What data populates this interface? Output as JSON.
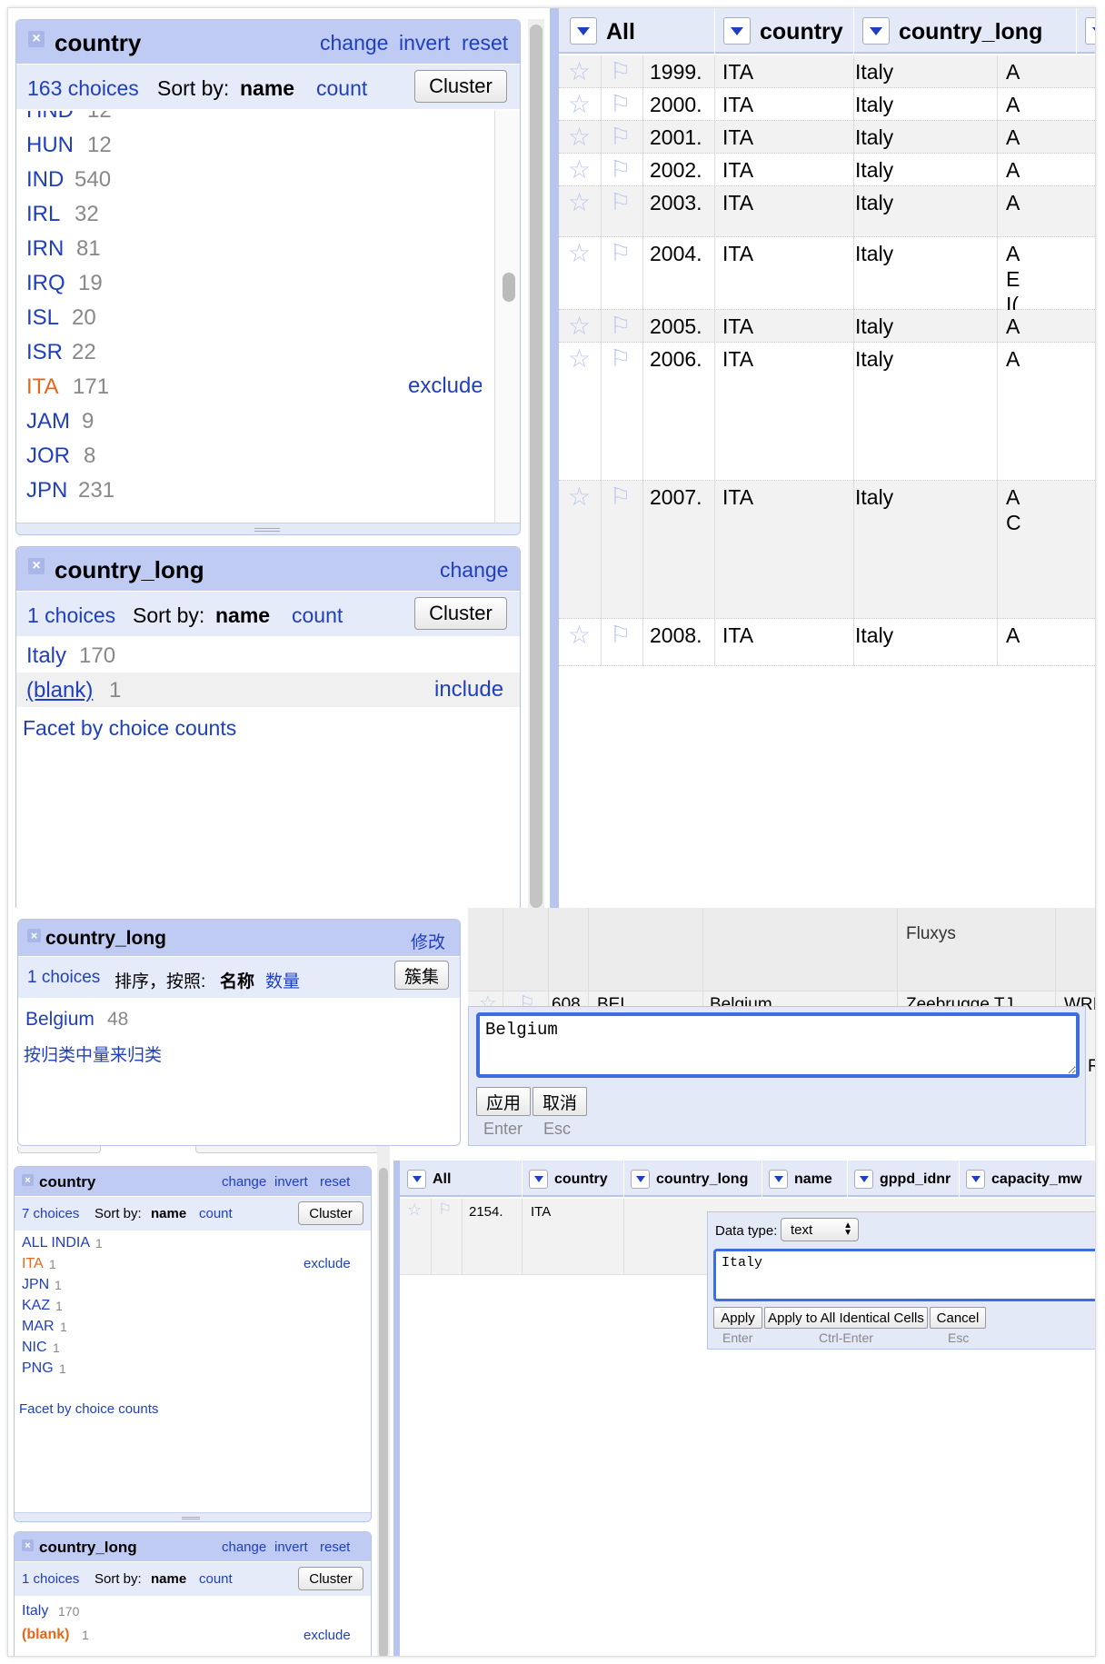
{
  "panel1": {
    "facet_country": {
      "title": "country",
      "actions": [
        "change",
        "invert",
        "reset"
      ],
      "choices_text": "163 choices",
      "sort_by": "Sort by:",
      "sort_name": "name",
      "sort_count": "count",
      "cluster": "Cluster",
      "items": [
        {
          "label": "HND",
          "count": "12"
        },
        {
          "label": "HUN",
          "count": "12"
        },
        {
          "label": "IND",
          "count": "540"
        },
        {
          "label": "IRL",
          "count": "32"
        },
        {
          "label": "IRN",
          "count": "81"
        },
        {
          "label": "IRQ",
          "count": "19"
        },
        {
          "label": "ISL",
          "count": "20"
        },
        {
          "label": "ISR",
          "count": "22"
        },
        {
          "label": "ITA",
          "count": "171",
          "action": "exclude"
        },
        {
          "label": "JAM",
          "count": "9"
        },
        {
          "label": "JOR",
          "count": "8"
        },
        {
          "label": "JPN",
          "count": "231"
        }
      ]
    },
    "facet_country_long": {
      "title": "country_long",
      "change": "change",
      "choices_text": "1 choices",
      "sort_by": "Sort by:",
      "sort_name": "name",
      "sort_count": "count",
      "cluster": "Cluster",
      "items": [
        {
          "label": "Italy",
          "count": "170"
        },
        {
          "label": "(blank)",
          "count": "1",
          "action": "include"
        }
      ],
      "facet_by_counts": "Facet by choice counts"
    },
    "columns": [
      "All",
      "country",
      "country_long"
    ],
    "rows": [
      {
        "n": "1999.",
        "c": "ITA",
        "cl": "Italy",
        "x": [
          "A"
        ]
      },
      {
        "n": "2000.",
        "c": "ITA",
        "cl": "Italy",
        "x": [
          "A"
        ]
      },
      {
        "n": "2001.",
        "c": "ITA",
        "cl": "Italy",
        "x": [
          "A"
        ]
      },
      {
        "n": "2002.",
        "c": "ITA",
        "cl": "Italy",
        "x": [
          "A"
        ]
      },
      {
        "n": "2003.",
        "c": "ITA",
        "cl": "Italy",
        "x": [
          "A"
        ]
      },
      {
        "n": "2004.",
        "c": "ITA",
        "cl": "Italy",
        "x": [
          "A",
          "E",
          "I("
        ]
      },
      {
        "n": "2005.",
        "c": "ITA",
        "cl": "Italy",
        "x": [
          "A"
        ]
      },
      {
        "n": "2006.",
        "c": "ITA",
        "cl": "Italy",
        "x": [
          "A"
        ]
      },
      {
        "n": "2007.",
        "c": "ITA",
        "cl": "Italy",
        "x": [
          "A",
          "C"
        ]
      },
      {
        "n": "2008.",
        "c": "ITA",
        "cl": "Italy",
        "x": [
          "A"
        ]
      }
    ]
  },
  "panel2": {
    "facet": {
      "title": "country_long",
      "change": "修改",
      "choices_text": "1 choices",
      "sort_by": "排序，按照:",
      "sort_name": "名称",
      "sort_count": "数量",
      "cluster": "簇集",
      "item_label": "Belgium",
      "item_count": "48",
      "facet_by_counts": "按归类中量来归类"
    },
    "top_row_text": "Fluxys",
    "row": {
      "n": "608.",
      "c": "BEL",
      "cl": "Belgium",
      "name": "Zeebrugge TJ",
      "x": "WRI"
    },
    "editor_value": "Belgium",
    "apply": "应用",
    "cancel": "取消",
    "enter": "Enter",
    "esc": "Esc",
    "right_edge": "RI"
  },
  "panel3": {
    "facet_country": {
      "title": "country",
      "actions": [
        "change",
        "invert",
        "reset"
      ],
      "choices_text": "7 choices",
      "sort_by": "Sort by:",
      "sort_name": "name",
      "sort_count": "count",
      "cluster": "Cluster",
      "items": [
        {
          "label": "ALL INDIA",
          "count": "1"
        },
        {
          "label": "ITA",
          "count": "1",
          "action": "exclude"
        },
        {
          "label": "JPN",
          "count": "1"
        },
        {
          "label": "KAZ",
          "count": "1"
        },
        {
          "label": "MAR",
          "count": "1"
        },
        {
          "label": "NIC",
          "count": "1"
        },
        {
          "label": "PNG",
          "count": "1"
        }
      ],
      "facet_by_counts": "Facet by choice counts"
    },
    "facet_country_long": {
      "title": "country_long",
      "actions": [
        "change",
        "invert",
        "reset"
      ],
      "choices_text": "1 choices",
      "sort_by": "Sort by:",
      "sort_name": "name",
      "sort_count": "count",
      "cluster": "Cluster",
      "items": [
        {
          "label": "Italy",
          "count": "170"
        },
        {
          "label": "(blank)",
          "count": "1",
          "action": "exclude"
        }
      ]
    },
    "columns": [
      "All",
      "country",
      "country_long",
      "name",
      "gppd_idnr",
      "capacity_mw"
    ],
    "row": {
      "n": "2154.",
      "c": "ITA"
    },
    "editor": {
      "data_type_label": "Data type:",
      "data_type": "text",
      "value": "Italy",
      "apply": "Apply",
      "apply_all": "Apply to All Identical Cells",
      "cancel": "Cancel",
      "enter": "Enter",
      "ctrl_enter": "Ctrl-Enter",
      "esc": "Esc"
    }
  }
}
